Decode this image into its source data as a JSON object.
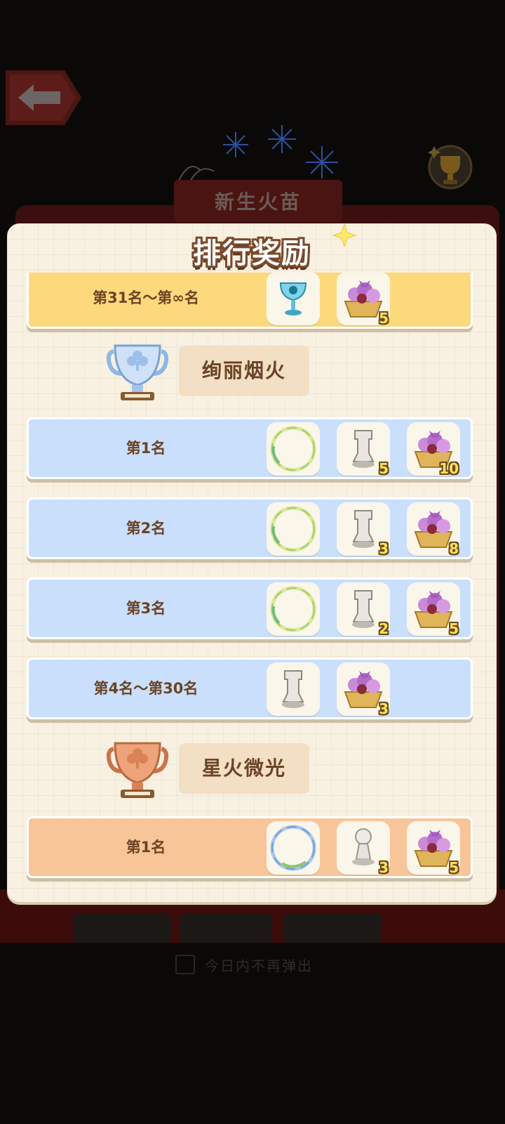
{
  "background": {
    "event_title": "新生火苗",
    "dont_show_today": "今日内不再弹出"
  },
  "modal": {
    "title": "排行奖励",
    "top_row": {
      "rank": "第31名～第∞名",
      "rewards": [
        {
          "icon": "crystal-goblet-icon",
          "qty": ""
        },
        {
          "icon": "flower-basket-icon",
          "qty": "5"
        }
      ]
    },
    "tiers": [
      {
        "name": "绚丽烟火",
        "cup": "silver-trophy-icon",
        "rows": [
          {
            "rank": "第1名",
            "rewards": [
              {
                "icon": "avatar-frame-icon",
                "qty": ""
              },
              {
                "icon": "chess-piece-icon",
                "qty": "5"
              },
              {
                "icon": "flower-basket-icon",
                "qty": "10"
              }
            ]
          },
          {
            "rank": "第2名",
            "rewards": [
              {
                "icon": "avatar-frame-icon",
                "qty": ""
              },
              {
                "icon": "chess-piece-icon",
                "qty": "3"
              },
              {
                "icon": "flower-basket-icon",
                "qty": "8"
              }
            ]
          },
          {
            "rank": "第3名",
            "rewards": [
              {
                "icon": "avatar-frame-icon",
                "qty": ""
              },
              {
                "icon": "chess-piece-icon",
                "qty": "2"
              },
              {
                "icon": "flower-basket-icon",
                "qty": "5"
              }
            ]
          },
          {
            "rank": "第4名～第30名",
            "rewards": [
              {
                "icon": "chess-piece-icon",
                "qty": ""
              },
              {
                "icon": "flower-basket-icon",
                "qty": "3"
              }
            ]
          }
        ]
      },
      {
        "name": "星火微光",
        "cup": "bronze-trophy-icon",
        "rows": [
          {
            "rank": "第1名",
            "rewards": [
              {
                "icon": "avatar-frame-blue-icon",
                "qty": ""
              },
              {
                "icon": "pawn-piece-icon",
                "qty": "3"
              },
              {
                "icon": "flower-basket-icon",
                "qty": "5"
              }
            ]
          }
        ]
      }
    ]
  },
  "colors": {
    "gold_row": "#fcd97c",
    "blue_row": "#cadffb",
    "orange_row": "#f8c598",
    "rank_text": "#6b4426"
  }
}
